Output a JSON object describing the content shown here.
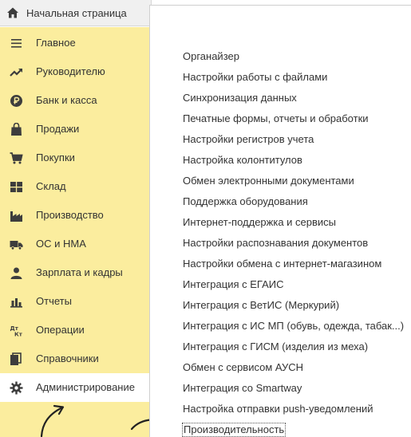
{
  "home": {
    "title": "Начальная страница",
    "icon": "home-icon"
  },
  "sidebar": {
    "items": [
      {
        "label": "Главное",
        "icon": "menu-lines-icon"
      },
      {
        "label": "Руководителю",
        "icon": "trend-up-icon"
      },
      {
        "label": "Банк и касса",
        "icon": "ruble-coin-icon"
      },
      {
        "label": "Продажи",
        "icon": "shopping-bag-icon"
      },
      {
        "label": "Покупки",
        "icon": "cart-icon"
      },
      {
        "label": "Склад",
        "icon": "warehouse-grid-icon"
      },
      {
        "label": "Производство",
        "icon": "factory-icon"
      },
      {
        "label": "ОС и НМА",
        "icon": "truck-icon"
      },
      {
        "label": "Зарплата и кадры",
        "icon": "person-icon"
      },
      {
        "label": "Отчеты",
        "icon": "bar-chart-icon"
      },
      {
        "label": "Операции",
        "icon": "debit-credit-icon"
      },
      {
        "label": "Справочники",
        "icon": "books-icon"
      },
      {
        "label": "Администрирование",
        "icon": "gear-icon"
      }
    ],
    "active_index": 12
  },
  "content": {
    "links": [
      "Органайзер",
      "Настройки работы с файлами",
      "Синхронизация данных",
      "Печатные формы, отчеты и обработки",
      "Настройки регистров учета",
      "Настройка колонтитулов",
      "Обмен электронными документами",
      "Поддержка оборудования",
      "Интернет-поддержка и сервисы",
      "Настройки распознавания документов",
      "Настройки обмена с интернет-магазином",
      "Интеграция с ЕГАИС",
      "Интеграция с ВетИС (Меркурий)",
      "Интеграция с ИС МП (обувь, одежда, табак...)",
      "Интеграция с ГИСМ (изделия из меха)",
      "Обмен с сервисом АУСН",
      "Интеграция со Smartway",
      "Настройка отправки push-уведомлений",
      "Производительность"
    ],
    "focused_index": 18
  },
  "colors": {
    "sidebar_bg": "#fbed9e",
    "icon": "#3d3d3d",
    "text": "#333333",
    "active_bg": "#ffffff"
  }
}
